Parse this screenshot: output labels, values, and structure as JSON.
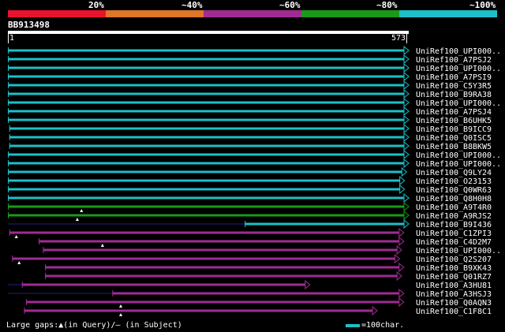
{
  "scale": {
    "labels": [
      "20%",
      "~40%",
      "~60%",
      "~80%",
      "~100%"
    ],
    "colors": [
      "#e8132d",
      "#e07628",
      "#a02b93",
      "#1a9a1a",
      "#1cc0c8"
    ]
  },
  "query": {
    "name": "BB913498",
    "start": "1",
    "end": "573",
    "length": 573
  },
  "colors": {
    "cyan": "#1cc0c8",
    "green": "#1a9a1a",
    "purple": "#a02b93",
    "dark": "#101040"
  },
  "hits": [
    {
      "name": "UniRef100_UPI000..",
      "color": "cyan",
      "start": 1,
      "end": 573
    },
    {
      "name": "UniRef100_A7PSJ2",
      "color": "cyan",
      "start": 1,
      "end": 573
    },
    {
      "name": "UniRef100_UPI000..",
      "color": "cyan",
      "start": 1,
      "end": 573
    },
    {
      "name": "UniRef100_A7PSI9",
      "color": "cyan",
      "start": 1,
      "end": 573
    },
    {
      "name": "UniRef100_C5Y3R5",
      "color": "cyan",
      "start": 1,
      "end": 573
    },
    {
      "name": "UniRef100_B9RA38",
      "color": "cyan",
      "start": 1,
      "end": 573
    },
    {
      "name": "UniRef100_UPI000..",
      "color": "cyan",
      "start": 1,
      "end": 573
    },
    {
      "name": "UniRef100_A7PSJ4",
      "color": "cyan",
      "start": 1,
      "end": 573
    },
    {
      "name": "UniRef100_B6UHK5",
      "color": "cyan",
      "start": 1,
      "end": 573
    },
    {
      "name": "UniRef100_B9ICC9",
      "color": "cyan",
      "start": 3,
      "end": 573
    },
    {
      "name": "UniRef100_Q0ISC5",
      "color": "cyan",
      "start": 3,
      "end": 573
    },
    {
      "name": "UniRef100_B8BKW5",
      "color": "cyan",
      "start": 3,
      "end": 573
    },
    {
      "name": "UniRef100_UPI000..",
      "color": "cyan",
      "start": 1,
      "end": 573
    },
    {
      "name": "UniRef100_UPI000..",
      "color": "cyan",
      "start": 1,
      "end": 573
    },
    {
      "name": "UniRef100_Q9LY24",
      "color": "cyan",
      "start": 1,
      "end": 570
    },
    {
      "name": "UniRef100_O23153",
      "color": "cyan",
      "start": 1,
      "end": 567
    },
    {
      "name": "UniRef100_Q0WR63",
      "color": "cyan",
      "start": 1,
      "end": 567
    },
    {
      "name": "UniRef100_Q8H0H8",
      "color": "cyan",
      "start": 1,
      "end": 573
    },
    {
      "name": "UniRef100_A9T4R0",
      "color": "green",
      "start": 1,
      "end": 573,
      "query_gap": 106
    },
    {
      "name": "UniRef100_A9RJS2",
      "color": "green",
      "start": 1,
      "end": 573,
      "query_gap": 100
    },
    {
      "name": "UniRef100_B9I436",
      "color": "cyan",
      "start": 339,
      "end": 573,
      "dark_start": 1,
      "dark_end": 339
    },
    {
      "name": "UniRef100_C1ZPI3",
      "color": "purple",
      "start": 3,
      "end": 566,
      "query_gap": 13
    },
    {
      "name": "UniRef100_C4D2M7",
      "color": "purple",
      "start": 45,
      "end": 566,
      "query_gap": 136
    },
    {
      "name": "UniRef100_UPI000..",
      "color": "purple",
      "start": 51,
      "end": 563
    },
    {
      "name": "UniRef100_Q2S207",
      "color": "purple",
      "start": 7,
      "end": 560,
      "query_gap": 17
    },
    {
      "name": "UniRef100_B9XK43",
      "color": "purple",
      "start": 54,
      "end": 566
    },
    {
      "name": "UniRef100_Q01RZ7",
      "color": "purple",
      "start": 54,
      "end": 563
    },
    {
      "name": "UniRef100_A3HU81",
      "color": "purple",
      "start": 21,
      "end": 432,
      "dark_start": 1,
      "dark_end": 21
    },
    {
      "name": "UniRef100_A3HSJ3",
      "color": "purple",
      "start": 150,
      "end": 566,
      "dark_start": 1,
      "dark_end": 150
    },
    {
      "name": "UniRef100_Q0AQN3",
      "color": "purple",
      "start": 27,
      "end": 566,
      "query_gap": 162
    },
    {
      "name": "UniRef100_C1F8C1",
      "color": "purple",
      "start": 24,
      "end": 528,
      "query_gap": 162
    }
  ],
  "legend": {
    "text": "Large gaps:▲(in Query)/— (in Subject)",
    "scale_text": "=100char."
  }
}
